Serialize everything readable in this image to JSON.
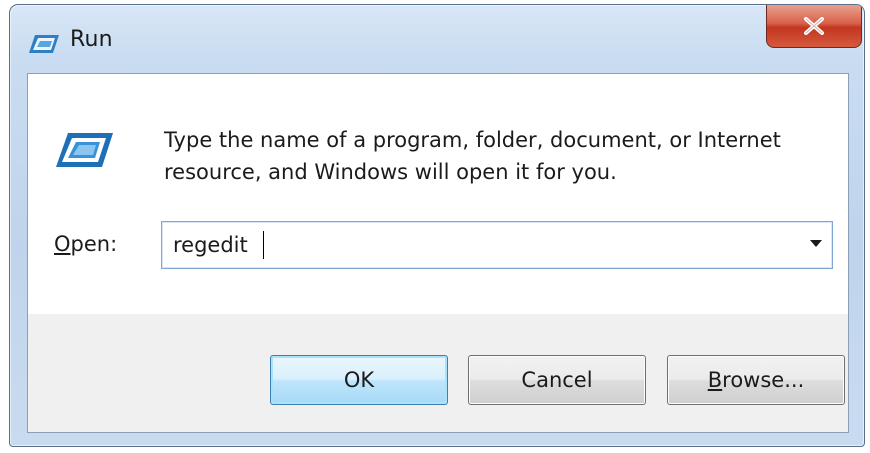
{
  "window": {
    "title": "Run",
    "title_icon": "run-icon",
    "close_label": "X"
  },
  "dialog": {
    "icon": "run-icon",
    "prompt": "Type the name of a program, folder, document, or Internet resource, and Windows will open it for you.",
    "open_label_mnemonic": "O",
    "open_label_rest": "pen:",
    "open_value": "regedit"
  },
  "buttons": {
    "ok_label": "OK",
    "cancel_label": "Cancel",
    "browse_mnemonic": "B",
    "browse_rest": "rowse..."
  },
  "colors": {
    "frame": "#c9dcf1",
    "close_button": "#c2361f",
    "default_button": "#bee6fd"
  }
}
